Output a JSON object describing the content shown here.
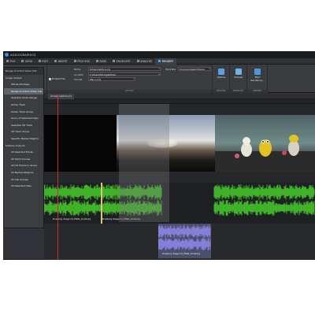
{
  "app": {
    "title": "AUDIOGRAPHICS"
  },
  "tabs": [
    {
      "label": "FILE"
    },
    {
      "label": "VIEW"
    },
    {
      "label": "EDIT"
    },
    {
      "label": "INSERT"
    },
    {
      "label": "PROCESS"
    },
    {
      "label": "FADE"
    },
    {
      "label": "ENVELOPE"
    },
    {
      "label": "ANALYZE"
    },
    {
      "label": "RENDER"
    }
  ],
  "active_tab": "RENDER",
  "ribbon": {
    "source_label": "Auto Select Source",
    "name_label": "Name",
    "name_value": "Screencapture-(1)",
    "template_label": "Template",
    "template_value": "Uncompressed Stereo",
    "location_label": "Location",
    "location_value": "C:\\Users\\Storage\\Music",
    "format_label": "Format",
    "format_value": "Wav (1.0)",
    "embed_label": "Embed File",
    "output_group": "OUTPUT",
    "options_btn": "Options",
    "options_group": "OPTIONS",
    "preview_btn": "Preview",
    "preview_group": "PRODUCE",
    "start_btn": "Start Rendering...",
    "render_group": "RENDER",
    "results_group": "RESULTS"
  },
  "menu": {
    "items": [
      {
        "label": "Range of Active Video Clip",
        "kind": "head-selected"
      },
      {
        "label": "Single Output",
        "kind": "head"
      },
      {
        "label": "Whole Montage",
        "kind": "item"
      },
      {
        "label": "Range of Active Video Clip",
        "kind": "sel"
      },
      {
        "label": "Selected Audio Range",
        "kind": "item"
      },
      {
        "label": "Active Track",
        "kind": "item"
      },
      {
        "label": "Active Track Group",
        "kind": "item"
      },
      {
        "label": "Union of Selected Clips",
        "kind": "item"
      },
      {
        "label": "Selected CD Track",
        "kind": "item"
      },
      {
        "label": "CD Track Group",
        "kind": "item"
      },
      {
        "label": "Specific Marked Region",
        "kind": "item"
      },
      {
        "label": "Multiple Outputs",
        "kind": "head"
      },
      {
        "label": "All Selected Tracks",
        "kind": "item"
      },
      {
        "label": "All Track Groups",
        "kind": "item"
      },
      {
        "label": "All CD Tracks in Group",
        "kind": "item"
      },
      {
        "label": "All Marked Regions",
        "kind": "item"
      },
      {
        "label": "All Clip Groups",
        "kind": "item"
      },
      {
        "label": "All Selected Clips",
        "kind": "item"
      }
    ]
  },
  "document": {
    "tab": "Screencapture-(1)"
  },
  "clips": {
    "audio_a": "Duisburg Image V4_FINAL_Duisburg",
    "audio_b": "Duisburg Image V4_FINAL_Duisburg",
    "audio_lower": "Duisburg Image V4_FINAL_Duisburg"
  },
  "track_head": {
    "num": "1",
    "label": "Show Rendering Box"
  },
  "colors": {
    "waveform": "#45c22b",
    "lower_waveform": "#8b86e6",
    "playhead": "#c7332b"
  }
}
